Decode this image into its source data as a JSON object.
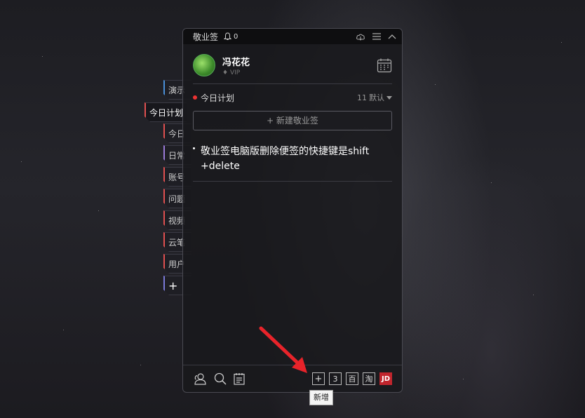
{
  "app": {
    "title": "敬业签",
    "notification_count": "0"
  },
  "side_tabs": [
    {
      "label": "演示"
    },
    {
      "label": "今日计划"
    },
    {
      "label": "今日"
    },
    {
      "label": "日常"
    },
    {
      "label": "账号"
    },
    {
      "label": "问题"
    },
    {
      "label": "视频"
    },
    {
      "label": "云笔"
    },
    {
      "label": "用户"
    },
    {
      "label": "+"
    }
  ],
  "profile": {
    "name": "冯花花",
    "badge": "VIP"
  },
  "plan": {
    "title": "今日计划",
    "count": "11",
    "sort_label": "默认"
  },
  "new_note_button": "+ 新建敬业签",
  "notes": [
    {
      "text": "敬业签电脑版删除便签的快捷键是shift +delete"
    }
  ],
  "bottom_bar": {
    "add": "+",
    "num": "3",
    "baidu": "百",
    "taobao": "淘",
    "jd": "JD"
  },
  "tooltip": "新增",
  "colors": {
    "accent_red": "#e33333",
    "jd_red": "#c0252d"
  }
}
